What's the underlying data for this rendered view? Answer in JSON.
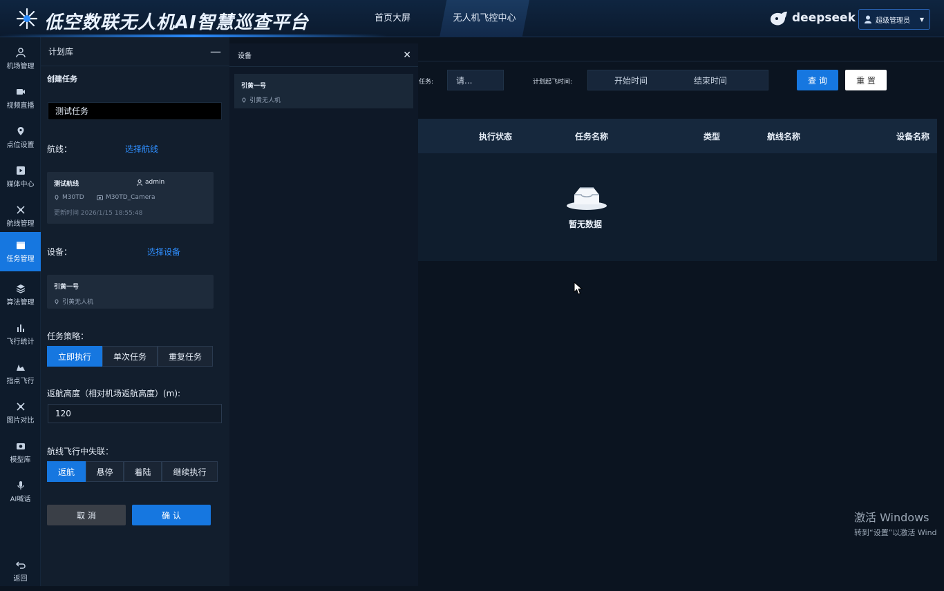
{
  "header": {
    "title": "低空数联无人机AI智慧巡查平台",
    "tabs": [
      "首页大屏",
      "无人机飞控中心"
    ],
    "brand": "deepseek",
    "user": "超级管理员"
  },
  "sidebar": {
    "items": [
      {
        "label": "机场管理",
        "icon": "user-icon"
      },
      {
        "label": "视频直播",
        "icon": "video-icon"
      },
      {
        "label": "点位设置",
        "icon": "location-pin-icon"
      },
      {
        "label": "媒体中心",
        "icon": "media-icon"
      },
      {
        "label": "航线管理",
        "icon": "drone-icon"
      },
      {
        "label": "任务管理",
        "icon": "task-icon",
        "active": true
      },
      {
        "label": "算法管理",
        "icon": "algorithm-icon"
      },
      {
        "label": "飞行统计",
        "icon": "bar-chart-icon"
      },
      {
        "label": "指点飞行",
        "icon": "point-flight-icon"
      },
      {
        "label": "图片对比",
        "icon": "compare-icon"
      },
      {
        "label": "模型库",
        "icon": "camera-icon"
      },
      {
        "label": "AI喊话",
        "icon": "microphone-icon"
      }
    ],
    "back_label": "返回"
  },
  "plan_panel": {
    "title": "计划库",
    "subtitle": "创建任务",
    "task_name_value": "测试任务",
    "route_label": "航线：",
    "route_link": "选择航线",
    "route_card": {
      "name": "测试航线",
      "user": "admin",
      "aircraft": "M30TD",
      "camera": "M30TD_Camera",
      "updated": "更新时间 2026/1/15 18:55:48"
    },
    "device_label": "设备：",
    "device_link": "选择设备",
    "device_card": {
      "name": "引黄一号",
      "type": "引黄无人机"
    },
    "strategy_label": "任务策略：",
    "strategy_options": [
      "立即执行",
      "单次任务",
      "重复任务"
    ],
    "return_height_label": "返航高度（相对机场返航高度）(m):",
    "return_height_value": "120",
    "lost_link_label": "航线飞行中失联：",
    "lost_link_options": [
      "返航",
      "悬停",
      "着陆",
      "继续执行"
    ],
    "cancel_label": "取 消",
    "confirm_label": "确 认"
  },
  "device_panel": {
    "title": "设备",
    "item": {
      "name": "引黄一号",
      "type": "引黄无人机"
    }
  },
  "filters": {
    "task_label": "任务:",
    "task_placeholder": "请...",
    "time_label": "计划起飞时间:",
    "start_placeholder": "开始时间",
    "end_placeholder": "结束时间",
    "query_label": "查 询",
    "reset_label": "重 置"
  },
  "table": {
    "columns": [
      "执行状态",
      "任务名称",
      "类型",
      "航线名称",
      "设备名称"
    ],
    "empty_text": "暂无数据"
  },
  "windows_activation": {
    "line1": "激活 Windows",
    "line2": "转到“设置”以激活 Wind"
  },
  "colors": {
    "accent": "#1677e0",
    "link": "#2f8fff",
    "background": "#0b1420"
  }
}
